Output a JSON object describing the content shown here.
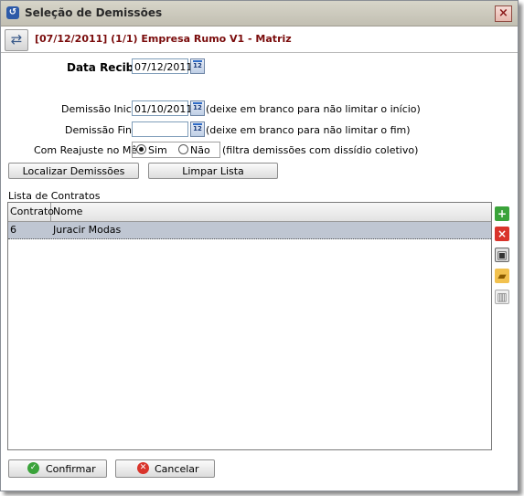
{
  "window": {
    "title": "Seleção de Demissões",
    "close": "×"
  },
  "header": {
    "text": "[07/12/2011] (1/1) Empresa Rumo V1 - Matriz",
    "swap_icon": "⇄"
  },
  "form": {
    "data_recibo_label": "Data Recibo",
    "data_recibo_value": "07/12/2011",
    "demissao_inicial_label": "Demissão Inicial",
    "demissao_inicial_value": "01/10/2011",
    "demissao_inicial_hint": "(deixe em branco para não limitar o início)",
    "demissao_final_label": "Demissão Final",
    "demissao_final_value": "",
    "demissao_final_hint": "(deixe em branco para não limitar o fim)",
    "reajuste_label": "Com Reajuste no Mês",
    "reajuste_options": [
      "Sim",
      "Não"
    ],
    "reajuste_selected": "Sim",
    "reajuste_hint": "(filtra demissões com dissídio coletivo)",
    "calendar_icon": "12"
  },
  "buttons": {
    "localizar": "Localizar Demissões",
    "limpar": "Limpar Lista",
    "confirmar": "Confirmar",
    "cancelar": "Cancelar"
  },
  "contracts": {
    "label": "Lista de Contratos",
    "columns": [
      "Contrato",
      "Nome"
    ],
    "rows": [
      {
        "contrato": "6",
        "nome": "Juracir Modas"
      }
    ]
  },
  "side_toolbar": [
    {
      "name": "add-icon",
      "glyph": "+"
    },
    {
      "name": "delete-icon",
      "glyph": "×"
    },
    {
      "name": "save-icon",
      "glyph": "▣"
    },
    {
      "name": "open-folder-icon",
      "glyph": "▰"
    },
    {
      "name": "trash-icon",
      "glyph": "▥"
    }
  ],
  "colors": {
    "header_text": "#7a0c0c",
    "selected_row": "#bfc6d2",
    "add": "#3aa33a",
    "delete": "#d9342b"
  }
}
